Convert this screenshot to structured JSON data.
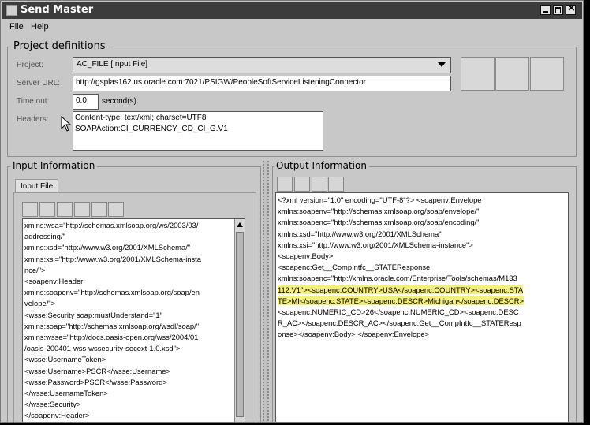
{
  "window": {
    "title": "Send Master"
  },
  "menu": {
    "file": "File",
    "help": "Help"
  },
  "project_definitions": {
    "title": "Project definitions",
    "project_label": "Project:",
    "project_value": "AC_FILE [Input File]",
    "server_url_label": "Server URL:",
    "server_url_value": "http://gsplas162.us.oracle.com:7021/PSIGW/PeopleSoftServiceListeningConnector",
    "timeout_label": "Time out:",
    "timeout_value": "0.0",
    "timeout_unit": "second(s)",
    "headers_label": "Headers:",
    "headers_lines": [
      "Content-type: text/xml; charset=UTF8",
      "SOAPAction:CI_CURRENCY_CD_CI_G.V1"
    ]
  },
  "input": {
    "title": "Input Information",
    "tab_label": "Input File",
    "lines": [
      "xmlns:wsa=\"http://schemas.xmlsoap.org/ws/2003/03/",
      "addressing/\"",
      "xmlns:xsd=\"http://www.w3.org/2001/XMLSchema/\"",
      "xmlns:xsi=\"http://www.w3.org/2001/XMLSchema-insta",
      "nce/\">",
      "  <soapenv:Header",
      "xmlns:soapenv=\"http://schemas.xmlsoap.org/soap/en",
      "velope/\">",
      "    <wsse:Security soap:mustUnderstand=\"1\"",
      "xmlns:soap=\"http://schemas.xmlsoap.org/wsdl/soap/\"",
      "xmlns:wsse=\"http://docs.oasis-open.org/wss/2004/01",
      "/oasis-200401-wss-wssecurity-secext-1.0.xsd\">",
      "      <wsse:UsernameToken>",
      "        <wsse:Username>PSCR</wsse:Username>",
      "        <wsse:Password>PSCR</wsse:Password>",
      "      </wsse:UsernameToken>",
      "    </wsse:Security>",
      "  </soapenv:Header>"
    ]
  },
  "output": {
    "title": "Output Information",
    "lines": [
      {
        "text": "<?xml version=\"1.0\" encoding=\"UTF-8\"?> <soapenv:Envelope",
        "hl": false
      },
      {
        "text": "xmlns:soapenv=\"http://schemas.xmlsoap.org/soap/envelope/\"",
        "hl": false
      },
      {
        "text": "xmlns:soapenc=\"http://schemas.xmlsoap.org/soap/encoding/\"",
        "hl": false
      },
      {
        "text": "xmlns:xsd=\"http://www.w3.org/2001/XMLSchema\"",
        "hl": false
      },
      {
        "text": "xmlns:xsi=\"http://www.w3.org/2001/XMLSchema-instance\">",
        "hl": false
      },
      {
        "text": "<soapenv:Body>",
        "hl": false
      },
      {
        "text": "<soapenc:Get__CompIntfc__STATEResponse",
        "hl": false
      },
      {
        "text": "xmlns:soapenc=\"http://xmlns.oracle.com/Enterprise/Tools/schemas/M133",
        "hl": false
      },
      {
        "text": "112.V1\"><soapenc:COUNTRY>USA</soapenc:COUNTRY><soapenc:STA",
        "hl": true
      },
      {
        "text": "TE>MI</soapenc:STATE><soapenc:DESCR>Michigan</soapenc:DESCR>",
        "hl": true
      },
      {
        "text": "<soapenc:NUMERIC_CD>26</soapenc:NUMERIC_CD><soapenc:DESC",
        "hl": false
      },
      {
        "text": "R_AC></soapenc:DESCR_AC></soapenc:Get__CompIntfc__STATEResp",
        "hl": false
      },
      {
        "text": "onse></soapenv:Body> </soapenv:Envelope>",
        "hl": false
      }
    ]
  },
  "colors": {
    "titlebar": "#3c3c3c",
    "highlight": "#f4f07a",
    "window_bg": "#c8c8c8"
  }
}
